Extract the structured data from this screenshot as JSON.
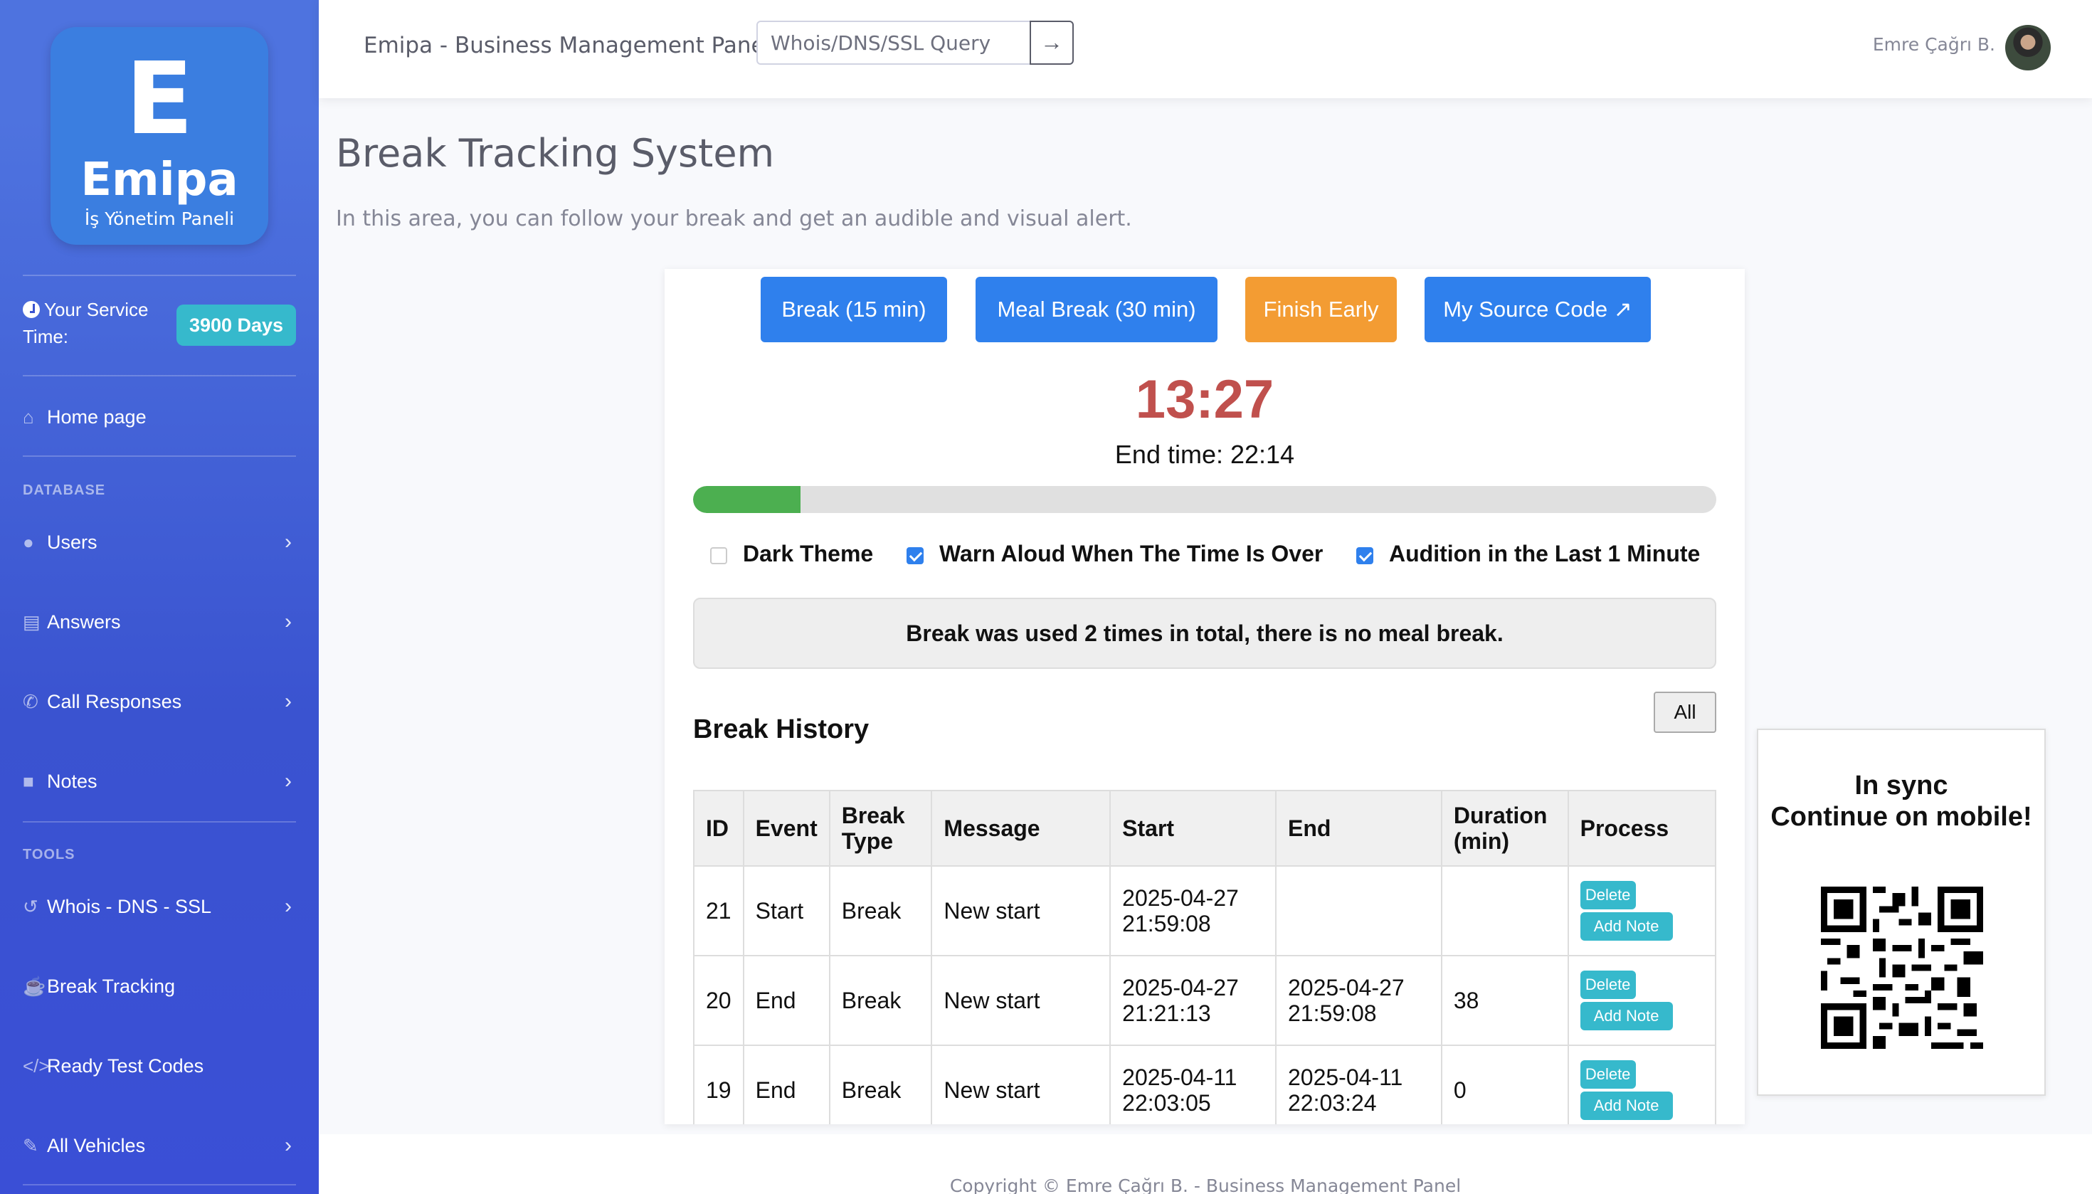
{
  "sidebar": {
    "logo_letter": "E",
    "logo_name": "Emipa",
    "logo_subtitle": "İş Yönetim Paneli",
    "service_label": "Your Service Time:",
    "service_days": "3900 Days",
    "items": [
      {
        "label": "Home page",
        "icon": "home-icon"
      },
      {
        "label": "Users",
        "icon": "user-icon"
      },
      {
        "label": "Answers",
        "icon": "clipboard-icon"
      },
      {
        "label": "Call Responses",
        "icon": "phone-icon"
      },
      {
        "label": "Notes",
        "icon": "sticky-note-icon"
      },
      {
        "label": "Whois - DNS - SSL",
        "icon": "history-icon"
      },
      {
        "label": "Break Tracking",
        "icon": "coffee-icon"
      },
      {
        "label": "Ready Test Codes",
        "icon": "code-icon"
      },
      {
        "label": "All Vehicles",
        "icon": "wrench-icon"
      }
    ],
    "heading_database": "DATABASE",
    "heading_tools": "TOOLS"
  },
  "topbar": {
    "title": "Emipa - Business Management Panel",
    "search_placeholder": "Whois/DNS/SSL Query",
    "user_name": "Emre Çağrı B."
  },
  "page": {
    "title": "Break Tracking System",
    "description": "In this area, you can follow your break and get an audible and visual alert."
  },
  "controls": {
    "break_btn": "Break (15 min)",
    "meal_btn": "Meal Break (30 min)",
    "finish_btn": "Finish Early",
    "source_btn": "My Source Code ↗",
    "timer": "13:27",
    "end_time": "End time: 22:14",
    "progress_fraction": 0.105,
    "options": [
      {
        "label": "Dark Theme",
        "checked": false
      },
      {
        "label": "Warn Aloud When The Time Is Over",
        "checked": true
      },
      {
        "label": "Audition in the Last 1 Minute",
        "checked": true
      }
    ],
    "info": "Break was used 2 times in total, there is no meal break.",
    "all_btn": "All",
    "history_title": "Break History"
  },
  "table": {
    "headers": [
      "ID",
      "Event",
      "Break Type",
      "Message",
      "Start",
      "End",
      "Duration (min)",
      "Process"
    ],
    "rows": [
      {
        "id": "21",
        "event": "Start",
        "type": "Break",
        "message": "New start",
        "start": "2025-04-27 21:59:08",
        "end": "",
        "duration": ""
      },
      {
        "id": "20",
        "event": "End",
        "type": "Break",
        "message": "New start",
        "start": "2025-04-27 21:21:13",
        "end": "2025-04-27 21:59:08",
        "duration": "38"
      },
      {
        "id": "19",
        "event": "End",
        "type": "Break",
        "message": "New start",
        "start": "2025-04-11 22:03:05",
        "end": "2025-04-11 22:03:24",
        "duration": "0"
      }
    ],
    "delete_label": "Delete",
    "add_note_label": "Add Note"
  },
  "qr_panel": {
    "line1": "In sync",
    "line2": "Continue on mobile!"
  },
  "footer": "Copyright © Emre Çağrı B. - Business Management Panel",
  "colors": {
    "sidebar": "#4e73df",
    "primary": "#2f80ed",
    "warning": "#f39c33",
    "timer": "#c0504d",
    "progress": "#4caf50",
    "info_badge": "#36b9cc"
  }
}
